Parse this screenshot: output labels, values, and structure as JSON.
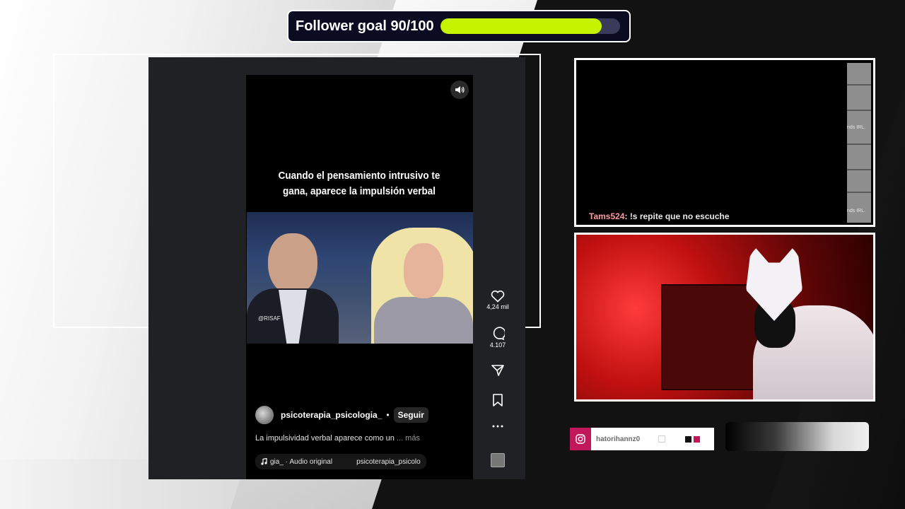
{
  "follower_goal": {
    "label": "Follower goal 90/100",
    "current": 90,
    "target": 100,
    "bar_color": "#c6f400"
  },
  "reel": {
    "caption": "Cuando el pensamiento intrusivo te gana, aparece la impulsión verbal",
    "watermark": "@RISAF",
    "likes": "4,24 mil",
    "comments": "4.107",
    "author": "psicoterapia_psicologia_",
    "separator": "•",
    "follow_label": "Seguir",
    "description": "La impulsividad verbal aparece como un",
    "more_label": "... más",
    "audio_artist": "gia_",
    "audio_label": "· Audio original",
    "audio_account": "psicoterapia_psicolo",
    "icons": [
      "speaker-icon",
      "heart-icon",
      "comment-icon",
      "share-icon",
      "bookmark-icon",
      "more-icon"
    ]
  },
  "chat": {
    "username": "Tams524",
    "message": ": !s repite que no escuche",
    "side_labels": [
      "nds IRL.",
      "nds IRL."
    ]
  },
  "instagram": {
    "handle": "hatorihannz0",
    "icon": "instagram-icon",
    "accent": "#c2185b"
  }
}
